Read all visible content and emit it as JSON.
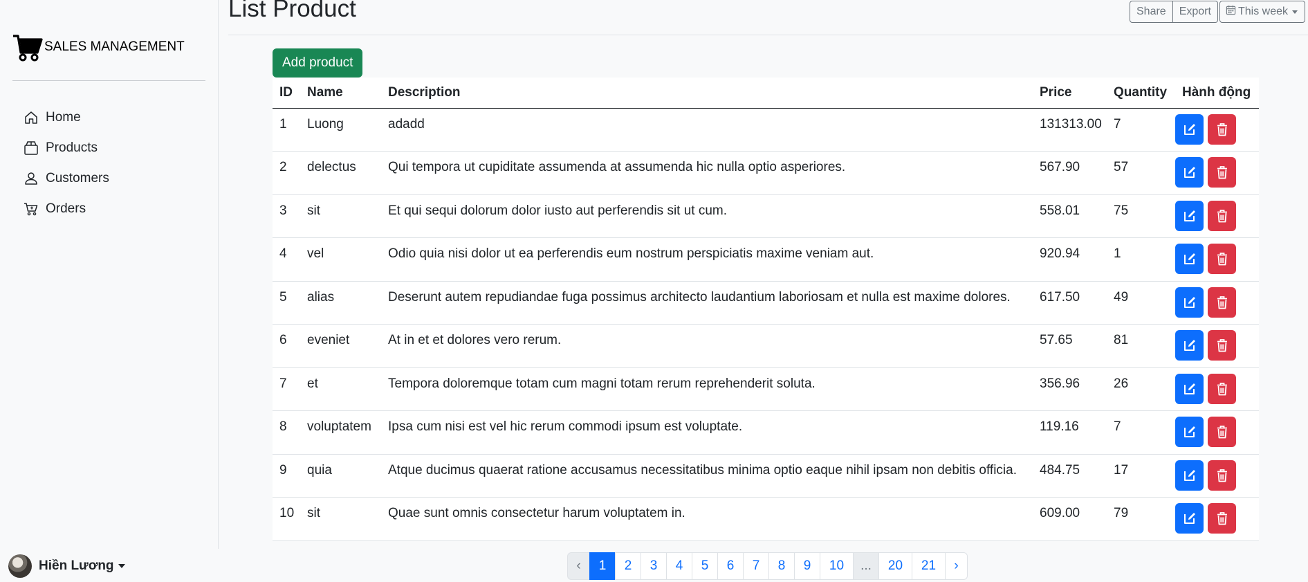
{
  "brand": {
    "name": "SALES MANAGEMENT",
    "icon": "cart-icon"
  },
  "sidebar": {
    "items": [
      {
        "label": "Home",
        "icon": "house-icon"
      },
      {
        "label": "Products",
        "icon": "box-icon"
      },
      {
        "label": "Customers",
        "icon": "person-icon"
      },
      {
        "label": "Orders",
        "icon": "cart-small-icon"
      }
    ]
  },
  "user": {
    "name": "Hiền Lương"
  },
  "header": {
    "title": "List Product",
    "share_label": "Share",
    "export_label": "Export",
    "period_label": "This week"
  },
  "add_button_label": "Add product",
  "table": {
    "columns": [
      "ID",
      "Name",
      "Description",
      "Price",
      "Quantity",
      "Hành động"
    ],
    "rows": [
      {
        "id": "1",
        "name": "Luong",
        "description": "adadd",
        "price": "131313.00",
        "quantity": "7"
      },
      {
        "id": "2",
        "name": "delectus",
        "description": "Qui tempora ut cupiditate assumenda at assumenda hic nulla optio asperiores.",
        "price": "567.90",
        "quantity": "57"
      },
      {
        "id": "3",
        "name": "sit",
        "description": "Et qui sequi dolorum dolor iusto aut perferendis sit ut cum.",
        "price": "558.01",
        "quantity": "75"
      },
      {
        "id": "4",
        "name": "vel",
        "description": "Odio quia nisi dolor ut ea perferendis eum nostrum perspiciatis maxime veniam aut.",
        "price": "920.94",
        "quantity": "1"
      },
      {
        "id": "5",
        "name": "alias",
        "description": "Deserunt autem repudiandae fuga possimus architecto laudantium laboriosam et nulla est maxime dolores.",
        "price": "617.50",
        "quantity": "49"
      },
      {
        "id": "6",
        "name": "eveniet",
        "description": "At in et et dolores vero rerum.",
        "price": "57.65",
        "quantity": "81"
      },
      {
        "id": "7",
        "name": "et",
        "description": "Tempora doloremque totam cum magni totam rerum reprehenderit soluta.",
        "price": "356.96",
        "quantity": "26"
      },
      {
        "id": "8",
        "name": "voluptatem",
        "description": "Ipsa cum nisi est vel hic rerum commodi ipsum est voluptate.",
        "price": "119.16",
        "quantity": "7"
      },
      {
        "id": "9",
        "name": "quia",
        "description": "Atque ducimus quaerat ratione accusamus necessitatibus minima optio eaque nihil ipsam non debitis officia.",
        "price": "484.75",
        "quantity": "17"
      },
      {
        "id": "10",
        "name": "sit",
        "description": "Quae sunt omnis consectetur harum voluptatem in.",
        "price": "609.00",
        "quantity": "79"
      }
    ]
  },
  "pagination": {
    "prev": "‹",
    "next": "›",
    "pages": [
      "1",
      "2",
      "3",
      "4",
      "5",
      "6",
      "7",
      "8",
      "9",
      "10",
      "...",
      "20",
      "21"
    ],
    "active": "1"
  },
  "colors": {
    "primary": "#0d6efd",
    "success": "#198754",
    "danger": "#dc3545"
  }
}
